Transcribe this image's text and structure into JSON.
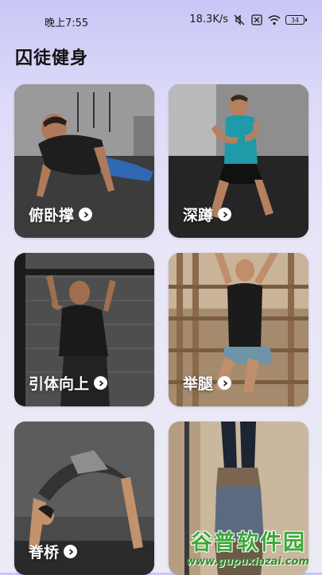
{
  "status_bar": {
    "time": "晚上7:55",
    "net_speed": "18.3K/s",
    "battery": "34",
    "icons": [
      "mute-icon",
      "sim-icon",
      "wifi-icon",
      "battery-icon"
    ]
  },
  "page": {
    "title": "囚徒健身"
  },
  "cards": [
    {
      "label": "俯卧撑",
      "icon": "chevron-right-circle-icon"
    },
    {
      "label": "深蹲",
      "icon": "chevron-right-circle-icon"
    },
    {
      "label": "引体向上",
      "icon": "chevron-right-circle-icon"
    },
    {
      "label": "举腿",
      "icon": "chevron-right-circle-icon"
    },
    {
      "label": "脊桥",
      "icon": "chevron-right-circle-icon"
    },
    {
      "label": "",
      "icon": ""
    }
  ],
  "watermark": {
    "title": "谷普软件园",
    "url": "www.gupuxiazai.com"
  },
  "colors": {
    "background_top": "#c9c6f6",
    "background_bottom": "#ecebf5",
    "watermark_green": "#3aa836"
  }
}
